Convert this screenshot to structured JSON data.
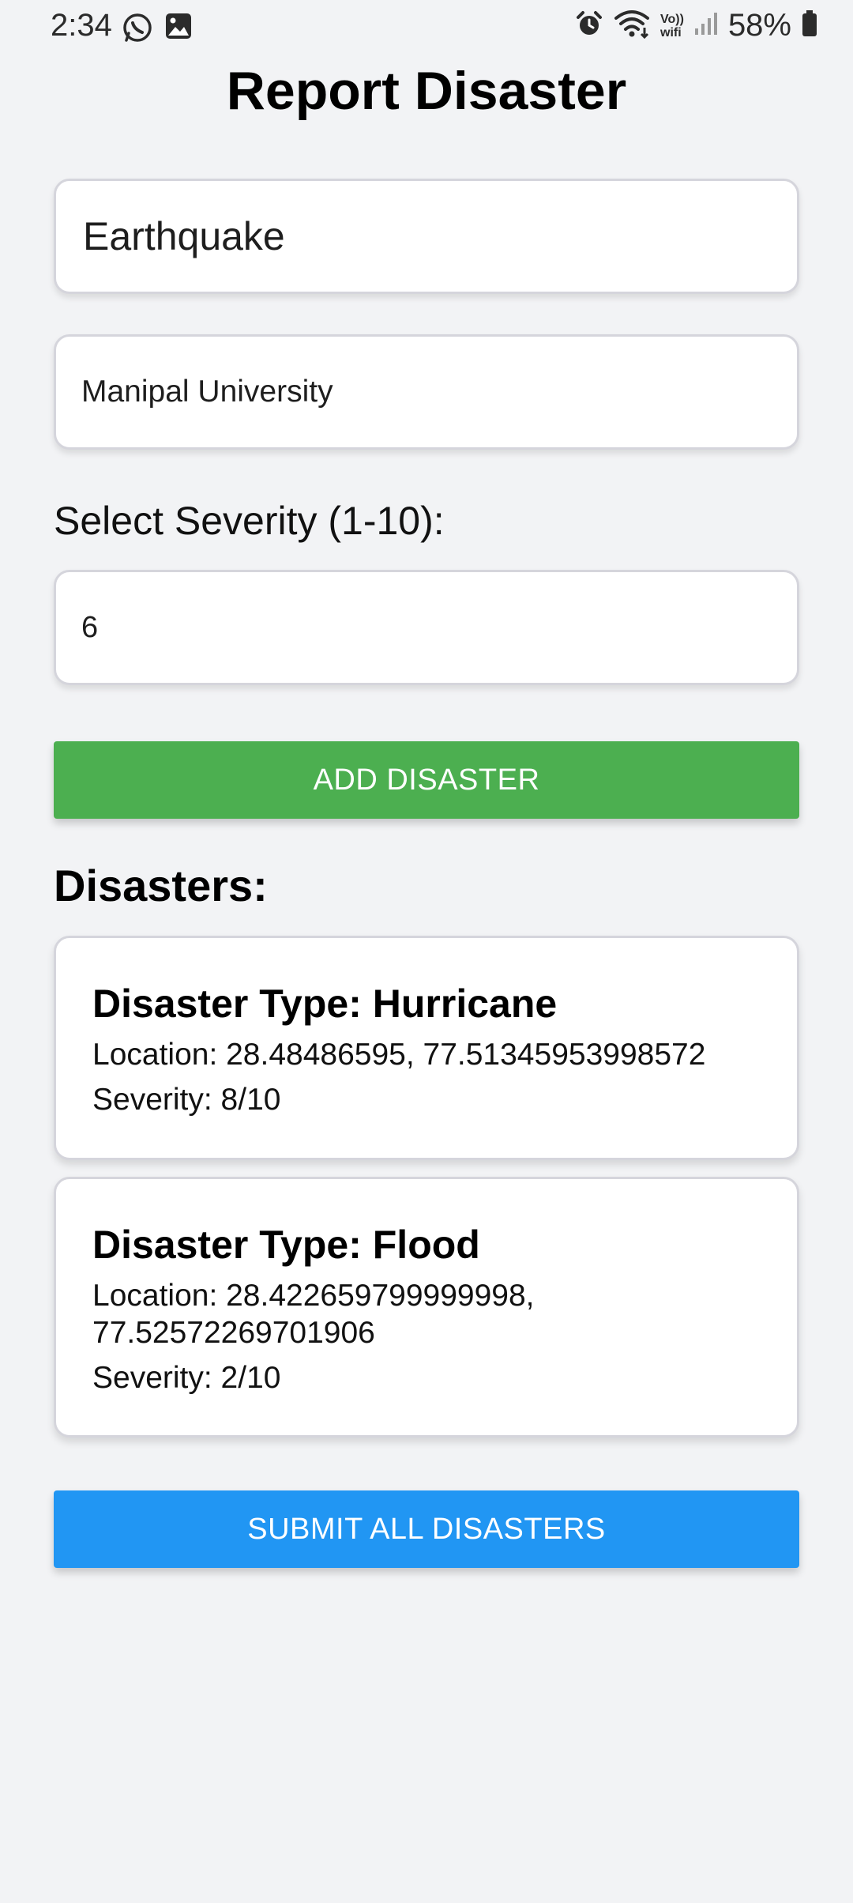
{
  "status_bar": {
    "time": "2:34",
    "battery": "58%",
    "icons": [
      "whatsapp-icon",
      "gallery-icon",
      "alarm-icon",
      "wifi-icon",
      "volte-wifi-icon",
      "signal-icon",
      "battery-icon"
    ],
    "volte_text_1": "Vo))",
    "volte_text_2": "wifi"
  },
  "page": {
    "title": "Report Disaster"
  },
  "form": {
    "type_value": "Earthquake",
    "location_value": "Manipal University",
    "severity_label": "Select Severity (1-10):",
    "severity_value": "6",
    "add_button": "ADD DISASTER"
  },
  "disasters": {
    "heading": "Disasters:",
    "items": [
      {
        "title": "Disaster Type: Hurricane",
        "location": "Location: 28.48486595, 77.51345953998572",
        "severity": "Severity: 8/10"
      },
      {
        "title": "Disaster Type: Flood",
        "location": "Location: 28.422659799999998, 77.52572269701906",
        "severity": "Severity: 2/10"
      }
    ]
  },
  "submit_button": "SUBMIT ALL DISASTERS",
  "colors": {
    "background": "#f2f3f5",
    "add_button": "#4caf50",
    "submit_button": "#2196f3"
  }
}
